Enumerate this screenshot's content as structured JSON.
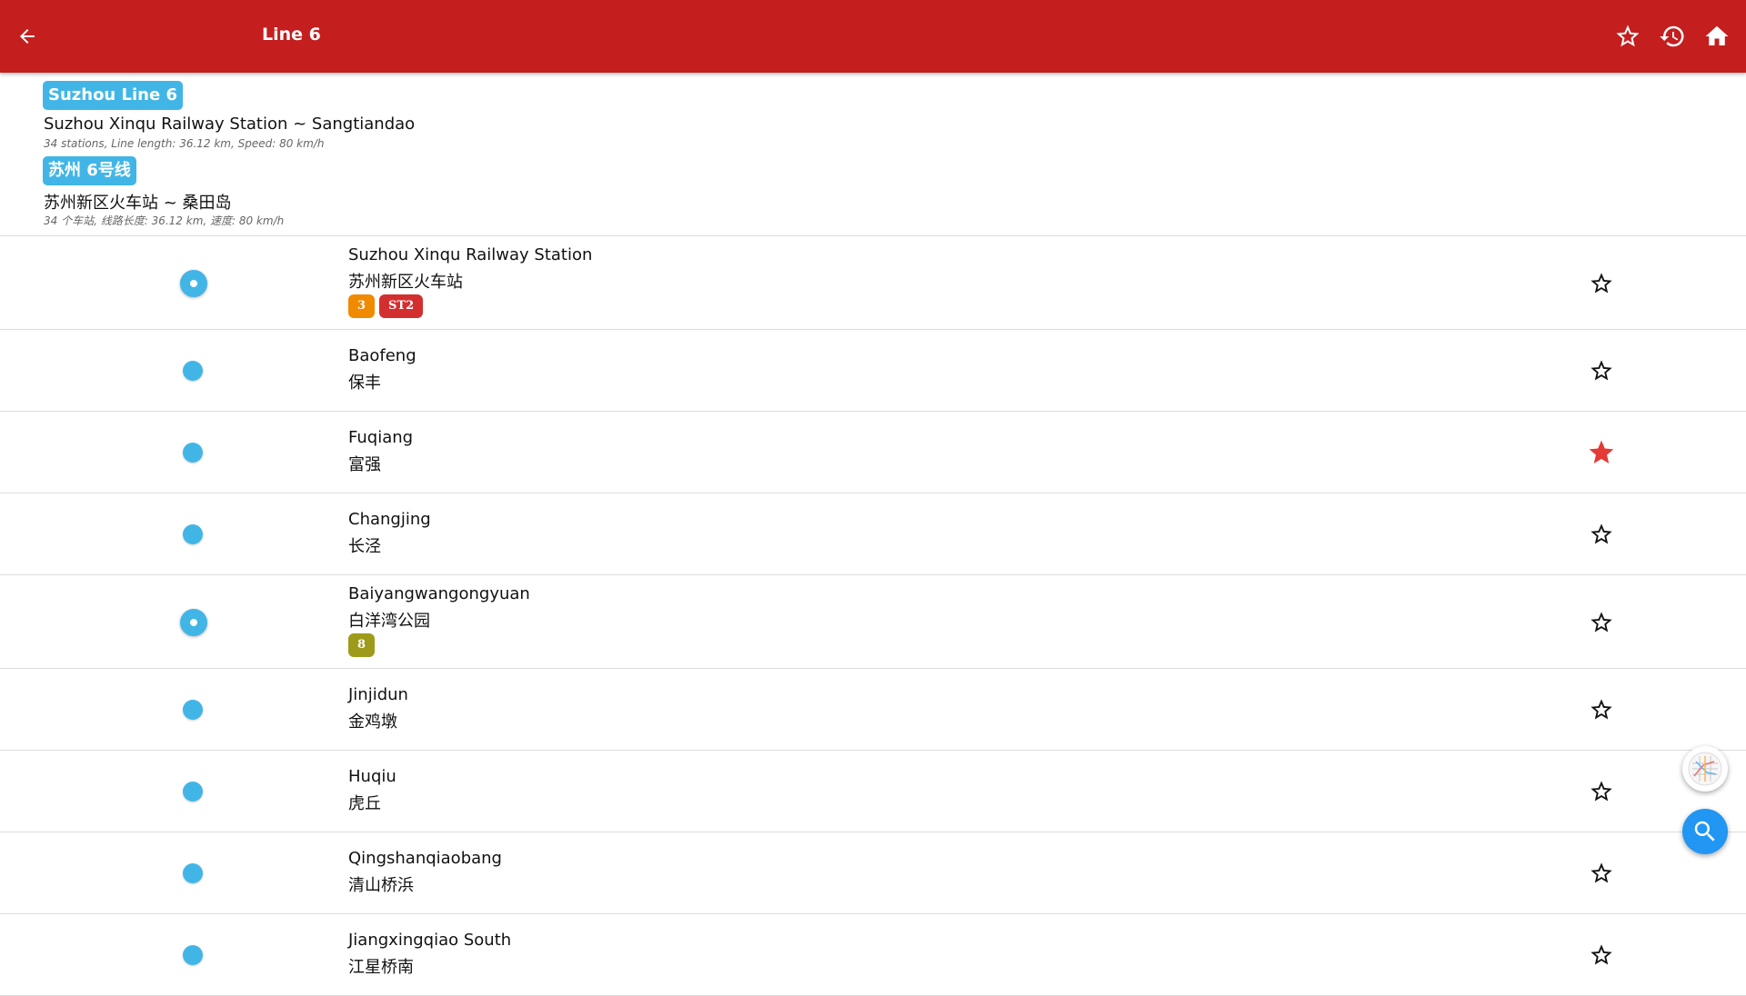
{
  "appbar": {
    "title": "Line 6",
    "icons": [
      "back-arrow-icon",
      "star-outline-icon",
      "history-icon",
      "home-icon"
    ],
    "color": "#c41e1e"
  },
  "line": {
    "badge_en": "Suzhou Line 6",
    "route_en": "Suzhou Xinqu Railway Station ~ Sangtiandao",
    "meta_en": "34 stations, Line length: 36.12 km, Speed: 80 km/h",
    "badge_cn": "苏州 6号线",
    "route_cn": "苏州新区火车站 ~ 桑田岛",
    "meta_cn": "34 个车站, 线路长度: 36.12 km, 速度: 80 km/h",
    "color": "#41b6e6"
  },
  "stations": [
    {
      "name_en": "Suzhou Xinqu Railway Station",
      "name_cn": "苏州新区火车站",
      "transfer": true,
      "favorite": false,
      "chips": [
        {
          "label": "3",
          "color": "#f08a00"
        },
        {
          "label": "ST2",
          "color": "#d32f2f"
        }
      ]
    },
    {
      "name_en": "Baofeng",
      "name_cn": "保丰",
      "transfer": false,
      "favorite": false,
      "chips": []
    },
    {
      "name_en": "Fuqiang",
      "name_cn": "富强",
      "transfer": false,
      "favorite": true,
      "chips": []
    },
    {
      "name_en": "Changjing",
      "name_cn": "长泾",
      "transfer": false,
      "favorite": false,
      "chips": []
    },
    {
      "name_en": "Baiyangwangongyuan",
      "name_cn": "白洋湾公园",
      "transfer": true,
      "favorite": false,
      "chips": [
        {
          "label": "8",
          "color": "#9e9a1a"
        }
      ]
    },
    {
      "name_en": "Jinjidun",
      "name_cn": "金鸡墩",
      "transfer": false,
      "favorite": false,
      "chips": []
    },
    {
      "name_en": "Huqiu",
      "name_cn": "虎丘",
      "transfer": false,
      "favorite": false,
      "chips": []
    },
    {
      "name_en": "Qingshanqiaobang",
      "name_cn": "清山桥浜",
      "transfer": false,
      "favorite": false,
      "chips": []
    },
    {
      "name_en": "Jiangxingqiao South",
      "name_cn": "江星桥南",
      "transfer": false,
      "favorite": false,
      "chips": []
    }
  ],
  "fabs": {
    "map_icon": "metro-map-icon",
    "search_icon": "search-icon",
    "search_color": "#2196f3"
  },
  "colors": {
    "favorite_star": "#e53935",
    "star_outline": "#111111"
  }
}
